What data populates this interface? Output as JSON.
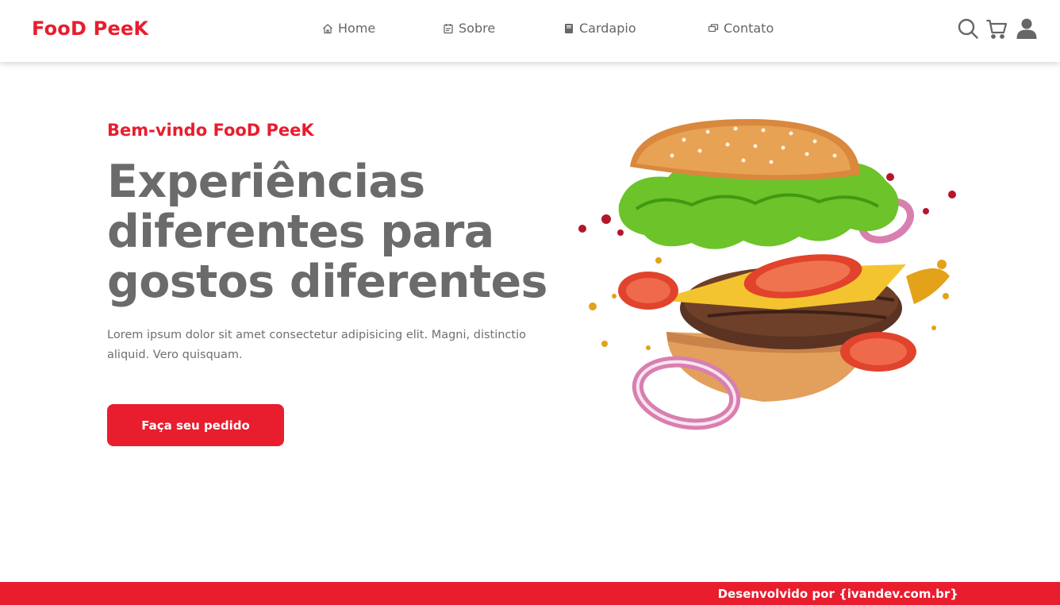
{
  "brand": {
    "logo": "FooD PeeK",
    "accent_color": "#e81d2e"
  },
  "nav": {
    "items": [
      {
        "label": "Home",
        "icon": "home-icon"
      },
      {
        "label": "Sobre",
        "icon": "calendar-icon"
      },
      {
        "label": "Cardapio",
        "icon": "book-icon"
      },
      {
        "label": "Contato",
        "icon": "chat-icon"
      }
    ],
    "actions": [
      "search-icon",
      "cart-icon",
      "user-icon"
    ]
  },
  "hero": {
    "subtitle": "Bem-vindo FooD PeeK",
    "title_lines": [
      "Experiências",
      "diferentes para",
      "gostos diferentes"
    ],
    "text": "Lorem ipsum dolor sit amet consectetur adipisicing elit. Magni, distinctio aliquid. Vero quisquam.",
    "cta_label": "Faça seu pedido"
  },
  "footer": {
    "text": "Desenvolvido por {ivandev.com.br}"
  }
}
